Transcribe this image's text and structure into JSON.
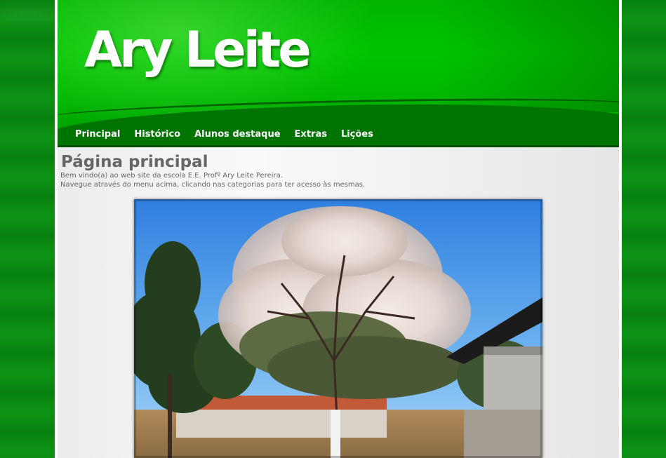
{
  "site": {
    "title": "Ary Leite"
  },
  "nav": {
    "items": [
      {
        "label": "Principal"
      },
      {
        "label": "Histórico"
      },
      {
        "label": "Alunos destaque"
      },
      {
        "label": "Extras"
      },
      {
        "label": "Lições"
      }
    ]
  },
  "main": {
    "heading": "Página principal",
    "intro_line1": "Bem vindo(a) ao web site da escola E.E. Profº Ary Leite Pereira.",
    "intro_line2": "Navegue através do menu acima, clicando nas categorias para ter acesso às mesmas."
  },
  "colors": {
    "header_green": "#00c000",
    "background_green": "#0b8a12",
    "text_gray": "#666666"
  }
}
